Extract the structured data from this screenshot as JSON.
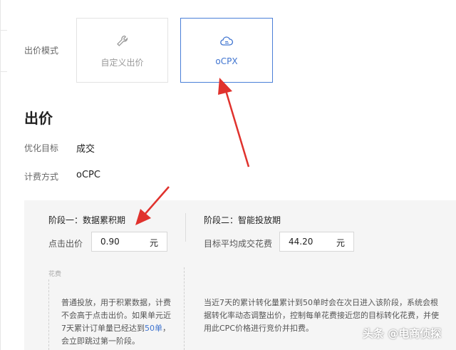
{
  "bid_mode": {
    "label": "出价模式",
    "options": [
      {
        "label": "自定义出价",
        "icon": "wrench-icon",
        "selected": false
      },
      {
        "label": "oCPX",
        "icon": "cloud-icon",
        "selected": true
      }
    ]
  },
  "section": {
    "title": "出价",
    "optimize_label": "优化目标",
    "optimize_value": "成交",
    "billing_label": "计费方式",
    "billing_value": "oCPC"
  },
  "stage1": {
    "title": "阶段一：数据累积期",
    "field_label": "点击出价",
    "value": "0.90",
    "unit": "元",
    "fee_label": "花费",
    "desc_pre": "普通投放，用于积累数据，计费不会高于点击出价。如果单元近7天累计订单量已经达到",
    "desc_highlight": "50单",
    "desc_post": "，会立即跳过第一阶段。"
  },
  "stage2": {
    "title": "阶段二：智能投放期",
    "field_label": "目标平均成交花费",
    "value": "44.20",
    "unit": "元",
    "desc": "当近7天的累计转化量累计到50单时会在次日进入该阶段，系统会根据转化率动态调整出价，控制每单花费接近您的目标转化花费，并使用此CPC价格进行竞价并扣费。"
  },
  "watermark": "头条 @电商侦探",
  "colors": {
    "accent": "#3f74d0",
    "arrow": "#e0322d",
    "panel": "#f5f5f5"
  }
}
